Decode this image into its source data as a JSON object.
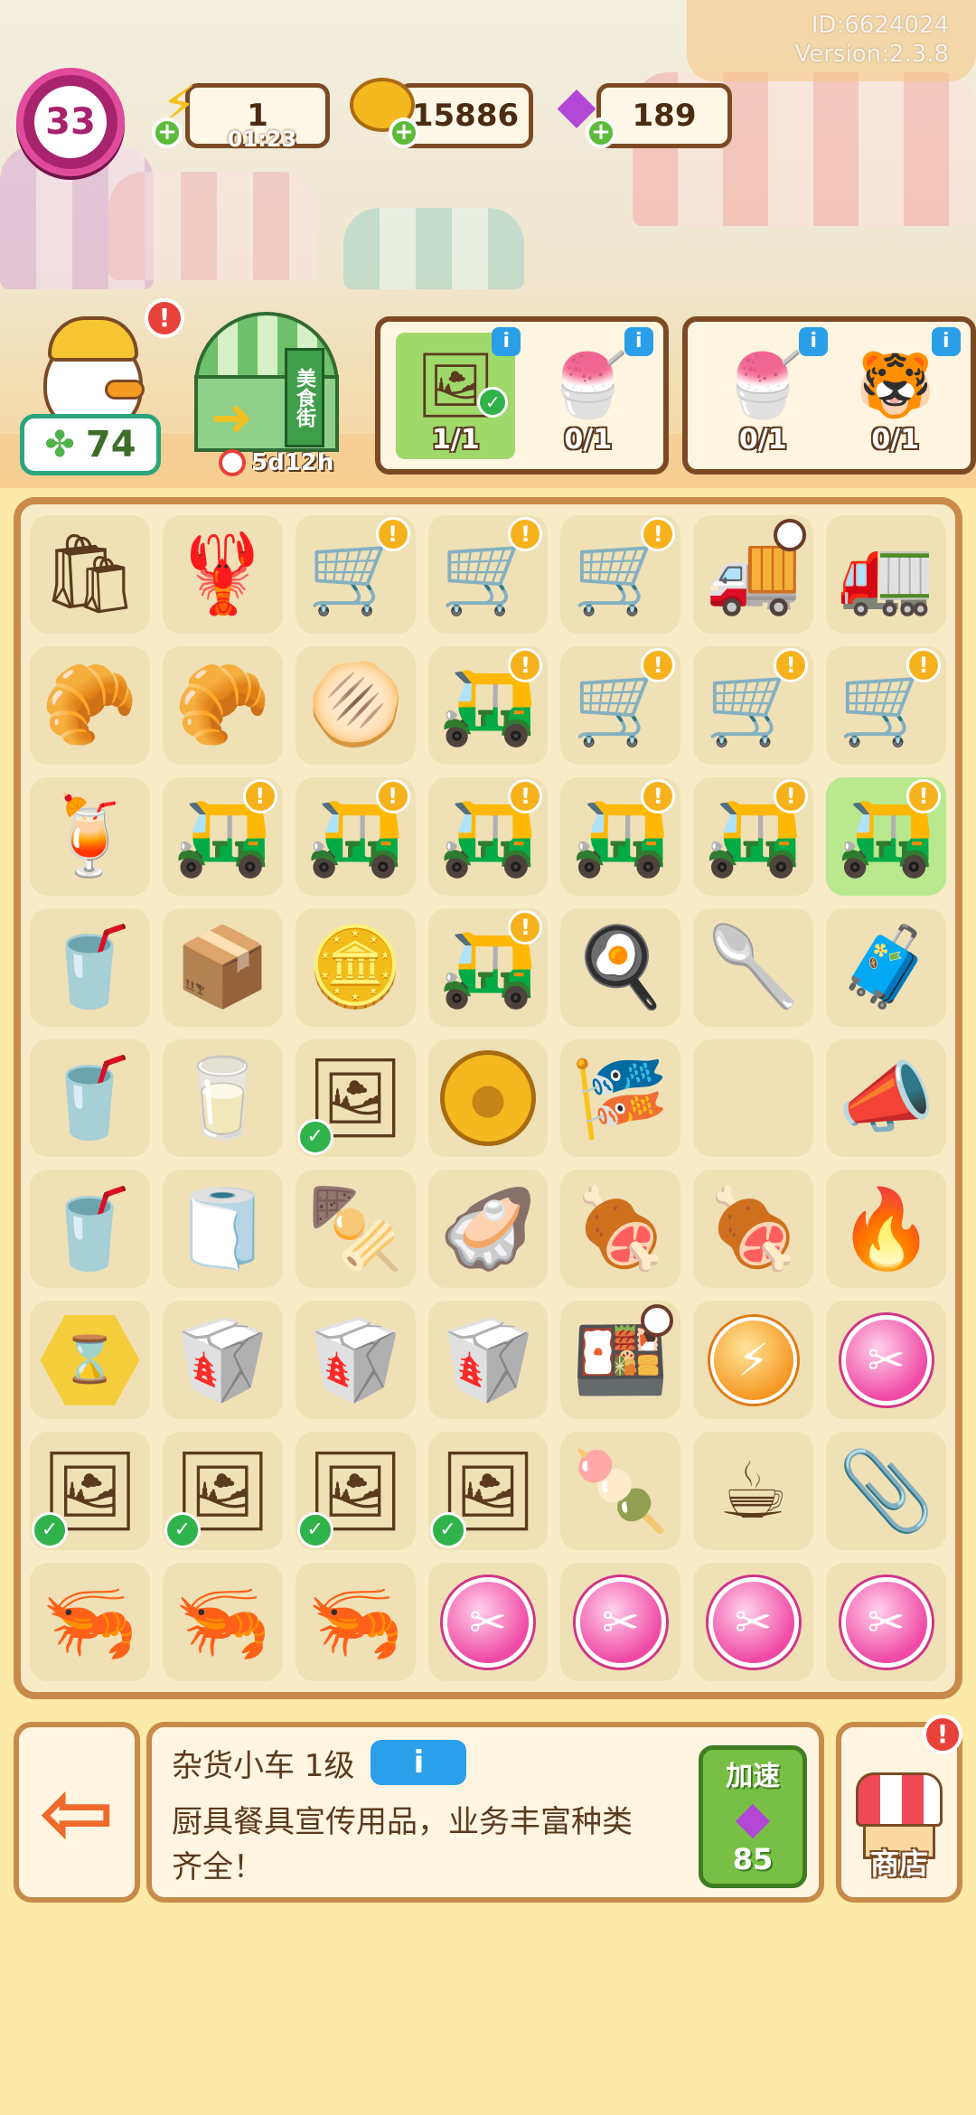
{
  "meta": {
    "id_text": "ID:6624024",
    "version_text": "Version:2.3.8"
  },
  "topbar": {
    "level": "33",
    "energy": {
      "value": "1",
      "timer": "01:23",
      "icon": "lightning-icon"
    },
    "coins": {
      "value": "15886",
      "icon": "coin-icon"
    },
    "gems": {
      "value": "189",
      "icon": "gem-icon"
    }
  },
  "character": {
    "clover_count": "74",
    "alert": "!"
  },
  "market": {
    "sign": "美食街",
    "timer": "5d12h"
  },
  "orders": [
    {
      "items": [
        {
          "name": "duck-poster",
          "count": "1/1",
          "done": true
        },
        {
          "name": "shaved-ice",
          "count": "0/1",
          "done": false
        }
      ]
    },
    {
      "items": [
        {
          "name": "shaved-ice",
          "count": "0/1",
          "done": false
        },
        {
          "name": "tiger-plush",
          "count": "0/1",
          "done": false
        }
      ]
    }
  ],
  "board": {
    "rows": [
      [
        "grocery-bag",
        "seafood-cart",
        "bbq-cart",
        "bbq-cart",
        "bbq-cart",
        "food-truck",
        "delivery-truck"
      ],
      [
        "bread-basket",
        "bread-basket",
        "flatbread",
        "noodle-cart",
        "bbq-cart",
        "bbq-cart",
        "bbq-cart"
      ],
      [
        "cocktail",
        "noodle-cart",
        "noodle-cart",
        "noodle-cart",
        "noodle-cart",
        "noodle-cart",
        "noodle-cart"
      ],
      [
        "rainbow-drink",
        "cardboard-boxes",
        "coin-stack",
        "noodle-cart",
        "frying-pan",
        "ladle",
        "parcel-trolley"
      ],
      [
        "rainbow-drink",
        "milk-jar",
        "duck-poster",
        "gold-coin",
        "bunting-flags",
        "empty",
        "megaphone"
      ],
      [
        "rainbow-drink",
        "paper-napkin",
        "skewer-plate",
        "oyster-plate",
        "grill-with-food",
        "grill-with-food",
        "charcoal-grill"
      ],
      [
        "hourglass-hex",
        "food-box",
        "food-box",
        "food-box",
        "bento-box",
        "energy-orb",
        "scissors-orb"
      ],
      [
        "duck-poster",
        "duck-poster",
        "duck-poster",
        "duck-poster",
        "duck-mochi",
        "duck-cup",
        "duck-clip"
      ],
      [
        "crayfish-plate",
        "crayfish-plate",
        "crayfish-plate",
        "scissors-orb",
        "scissors-orb",
        "scissors-orb",
        "scissors-orb"
      ]
    ]
  },
  "selected": {
    "title": "杂货小车 1级",
    "description": "厨具餐具宣传用品，业务丰富种类齐全！",
    "speed_label": "加速",
    "speed_cost": "85"
  },
  "buttons": {
    "shop_label": "商店",
    "exit_icon": "exit-arrow-icon"
  },
  "colors": {
    "board_border": "#c88a4a",
    "cell": "#efe0b6",
    "gem": "#b347d6",
    "accent_green": "#78c045",
    "level_pink": "#e14b9b"
  }
}
